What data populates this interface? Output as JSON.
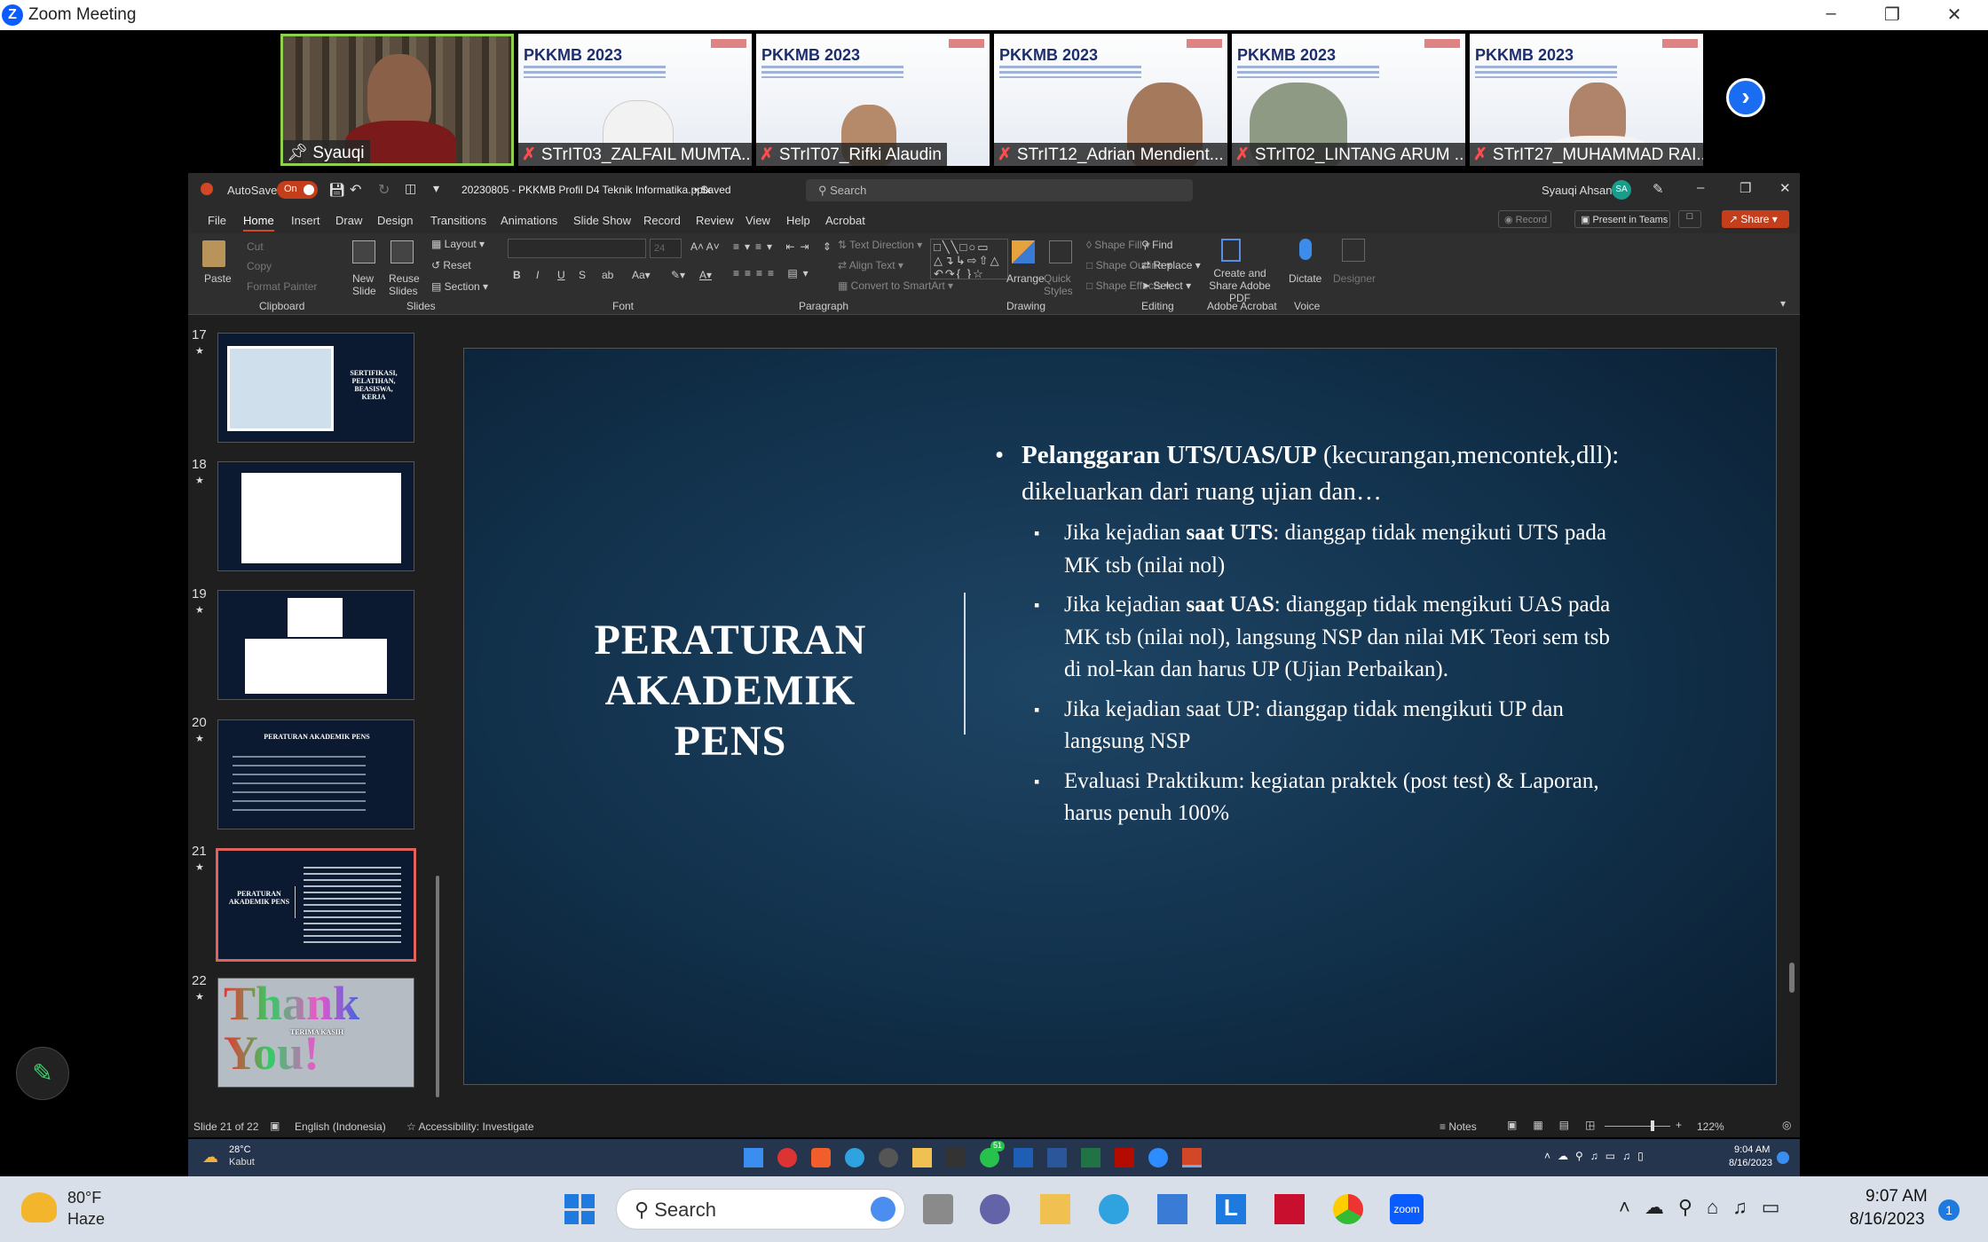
{
  "zoom": {
    "title": "Zoom Meeting"
  },
  "participants": [
    {
      "name": "Syauqi",
      "pinned": true,
      "muted": false
    },
    {
      "name": "STrIT03_ZALFAIL MUMTA...",
      "muted": true
    },
    {
      "name": "STrIT07_Rifki Alaudin",
      "muted": true
    },
    {
      "name": "STrIT12_Adrian Mendient...",
      "muted": true
    },
    {
      "name": "STrIT02_LINTANG ARUM ...",
      "muted": true
    },
    {
      "name": "STrIT27_MUHAMMAD RAI...",
      "muted": true
    }
  ],
  "pkkmb": {
    "banner": "PKKMB 2023"
  },
  "ppt": {
    "autosave": "AutoSave",
    "autosave_state": "On",
    "filename": "20230805 - PKKMB Profil D4 Teknik Informatika.pptx",
    "saved": "• Saved",
    "search": "Search",
    "user": "Syauqi Ahsan",
    "user_initials": "SA",
    "tabs": [
      "File",
      "Home",
      "Insert",
      "Draw",
      "Design",
      "Transitions",
      "Animations",
      "Slide Show",
      "Record",
      "Review",
      "View",
      "Help",
      "Acrobat"
    ],
    "record": "Record",
    "present": "Present in Teams",
    "share": "Share",
    "ribbon": {
      "paste": "Paste",
      "cut": "Cut",
      "copy": "Copy",
      "format_painter": "Format Painter",
      "clipboard": "Clipboard",
      "new_slide": "New Slide",
      "reuse": "Reuse Slides",
      "layout": "Layout",
      "reset": "Reset",
      "section": "Section",
      "slides": "Slides",
      "font_size": "24",
      "font": "Font",
      "text_direction": "Text Direction",
      "align_text": "Align Text",
      "convert": "Convert to SmartArt",
      "paragraph": "Paragraph",
      "arrange": "Arrange",
      "quick_styles": "Quick Styles",
      "shape_fill": "Shape Fill",
      "shape_outline": "Shape Outline",
      "shape_effects": "Shape Effects",
      "drawing": "Drawing",
      "find": "Find",
      "replace": "Replace",
      "select": "Select",
      "editing": "Editing",
      "create_pdf": "Create and Share Adobe PDF",
      "adobe": "Adobe Acrobat",
      "dictate": "Dictate",
      "voice": "Voice",
      "designer": "Designer"
    },
    "thumbnails": [
      {
        "num": "17",
        "title": "SERTIFIKASI, PELATIHAN, BEASISWA, KERJA"
      },
      {
        "num": "18",
        "title": ""
      },
      {
        "num": "19",
        "title": ""
      },
      {
        "num": "20",
        "title": "PERATURAN AKADEMIK PENS"
      },
      {
        "num": "21",
        "title": "PERATURAN AKADEMIK PENS",
        "selected": true
      },
      {
        "num": "22",
        "title": "Thank You!",
        "subtitle": "TERIMA KASIH"
      }
    ],
    "status": {
      "slide": "Slide 21 of 22",
      "lang": "English (Indonesia)",
      "access": "Accessibility: Investigate",
      "notes": "Notes",
      "zoom": "122%"
    }
  },
  "slide": {
    "title": "PERATURAN AKADEMIK PENS",
    "bullet_bold": "Pelanggaran UTS/UAS/UP",
    "bullet_rest": "(kecurangan,mencontek,dll): dikeluarkan dari ruang ujian dan…",
    "sub1_a": "Jika kejadian ",
    "sub1_b": "saat UTS",
    "sub1_c": ": dianggap tidak mengikuti UTS pada MK tsb (nilai nol)",
    "sub2_a": "Jika kejadian ",
    "sub2_b": "saat UAS",
    "sub2_c": ": dianggap tidak mengikuti UAS pada MK tsb (nilai nol), langsung NSP dan nilai MK Teori sem tsb di nol-kan dan harus UP (Ujian Perbaikan).",
    "sub3": "Jika kejadian saat UP: dianggap tidak mengikuti UP dan langsung NSP",
    "sub4": "Evaluasi Praktikum: kegiatan praktek (post test) & Laporan, harus penuh 100%"
  },
  "inner_taskbar": {
    "temp": "28°C",
    "weather": "Kabut",
    "time": "9:04 AM",
    "date": "8/16/2023",
    "whatsapp_badge": "51"
  },
  "taskbar": {
    "temp": "80°F",
    "weather": "Haze",
    "search": "Search",
    "time": "9:07 AM",
    "date": "8/16/2023",
    "notif": "1"
  }
}
